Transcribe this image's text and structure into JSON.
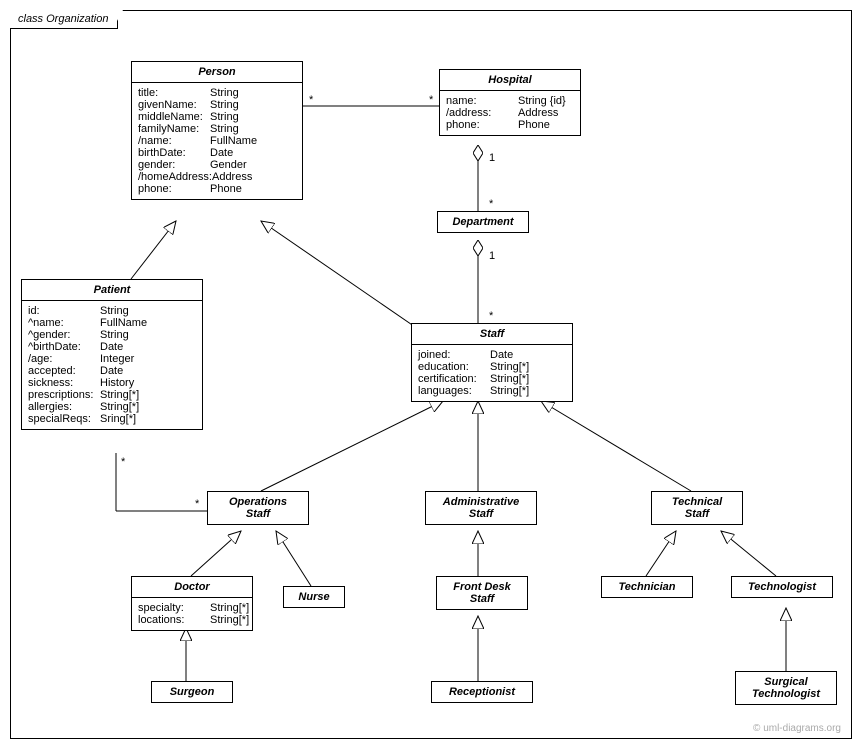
{
  "frame": {
    "label": "class Organization"
  },
  "credit": "© uml-diagrams.org",
  "classes": {
    "person": {
      "title": "Person",
      "attrs": [
        [
          "title:",
          "String"
        ],
        [
          "givenName:",
          "String"
        ],
        [
          "middleName:",
          "String"
        ],
        [
          "familyName:",
          "String"
        ],
        [
          "/name:",
          "FullName"
        ],
        [
          "birthDate:",
          "Date"
        ],
        [
          "gender:",
          "Gender"
        ],
        [
          "/homeAddress:",
          "Address"
        ],
        [
          "phone:",
          "Phone"
        ]
      ]
    },
    "hospital": {
      "title": "Hospital",
      "attrs": [
        [
          "name:",
          "String {id}"
        ],
        [
          "/address:",
          "Address"
        ],
        [
          "phone:",
          "Phone"
        ]
      ]
    },
    "department": {
      "title": "Department"
    },
    "patient": {
      "title": "Patient",
      "attrs": [
        [
          "id:",
          "String"
        ],
        [
          "^name:",
          "FullName"
        ],
        [
          "^gender:",
          "String"
        ],
        [
          "^birthDate:",
          "Date"
        ],
        [
          "/age:",
          "Integer"
        ],
        [
          "accepted:",
          "Date"
        ],
        [
          "sickness:",
          "History"
        ],
        [
          "prescriptions:",
          "String[*]"
        ],
        [
          "allergies:",
          "String[*]"
        ],
        [
          "specialReqs:",
          "Sring[*]"
        ]
      ]
    },
    "staff": {
      "title": "Staff",
      "attrs": [
        [
          "joined:",
          "Date"
        ],
        [
          "education:",
          "String[*]"
        ],
        [
          "certification:",
          "String[*]"
        ],
        [
          "languages:",
          "String[*]"
        ]
      ]
    },
    "opsStaff": {
      "title": "Operations\nStaff"
    },
    "adminStaff": {
      "title": "Administrative\nStaff"
    },
    "techStaff": {
      "title": "Technical\nStaff"
    },
    "doctor": {
      "title": "Doctor",
      "attrs": [
        [
          "specialty:",
          "String[*]"
        ],
        [
          "locations:",
          "String[*]"
        ]
      ]
    },
    "nurse": {
      "title": "Nurse"
    },
    "frontDesk": {
      "title": "Front Desk\nStaff"
    },
    "technician": {
      "title": "Technician"
    },
    "technologist": {
      "title": "Technologist"
    },
    "surgeon": {
      "title": "Surgeon"
    },
    "receptionist": {
      "title": "Receptionist"
    },
    "surgTech": {
      "title": "Surgical\nTechnologist"
    }
  },
  "multiplicities": {
    "personHosp_p": "*",
    "personHosp_h": "*",
    "hospDept_h": "1",
    "hospDept_d": "*",
    "deptStaff_d": "1",
    "deptStaff_s": "*",
    "patientOps_p": "*",
    "patientOps_o": "*"
  }
}
